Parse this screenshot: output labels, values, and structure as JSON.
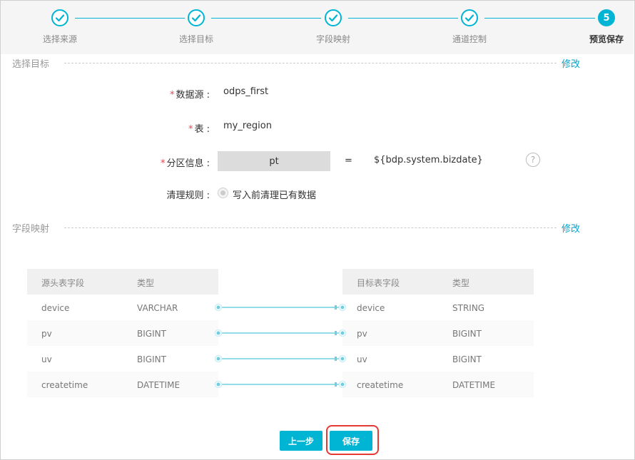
{
  "steps": [
    {
      "label": "选择来源",
      "state": "done",
      "icon": "check-icon"
    },
    {
      "label": "选择目标",
      "state": "done",
      "icon": "check-icon"
    },
    {
      "label": "字段映射",
      "state": "done",
      "icon": "check-icon"
    },
    {
      "label": "通道控制",
      "state": "done",
      "icon": "check-icon"
    },
    {
      "label": "预览保存",
      "state": "active",
      "number": "5"
    }
  ],
  "target_section": {
    "title": "选择目标",
    "edit_label": "修改",
    "datasource_label": "数据源 :",
    "datasource_value": "odps_first",
    "table_label": "表 :",
    "table_value": "my_region",
    "partition_label": "分区信息 :",
    "partition_key": "pt",
    "partition_equals": "=",
    "partition_value": "${bdp.system.bizdate}",
    "help_icon": "question-icon",
    "clean_label": "清理规则 :",
    "clean_option": "写入前清理已有数据",
    "required_mark": "*"
  },
  "mapping_section": {
    "title": "字段映射",
    "edit_label": "修改",
    "source_headers": [
      "源头表字段",
      "类型"
    ],
    "target_headers": [
      "目标表字段",
      "类型"
    ],
    "source_rows": [
      {
        "field": "device",
        "type": "VARCHAR"
      },
      {
        "field": "pv",
        "type": "BIGINT"
      },
      {
        "field": "uv",
        "type": "BIGINT"
      },
      {
        "field": "createtime",
        "type": "DATETIME"
      }
    ],
    "target_rows": [
      {
        "field": "device",
        "type": "STRING"
      },
      {
        "field": "pv",
        "type": "BIGINT"
      },
      {
        "field": "uv",
        "type": "BIGINT"
      },
      {
        "field": "createtime",
        "type": "DATETIME"
      }
    ]
  },
  "buttons": {
    "prev_label": "上一步",
    "save_label": "保存"
  },
  "colors": {
    "accent": "#00b4d4",
    "link": "#00a3cc",
    "required": "#e5484d",
    "highlight": "#e53935"
  }
}
